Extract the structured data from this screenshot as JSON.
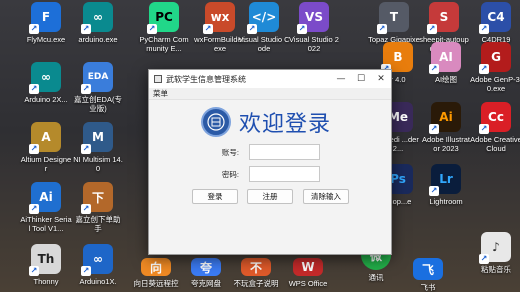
{
  "desktop": {
    "icons": [
      {
        "label": "FlyMcu.exe",
        "color": "#1d6fd8",
        "glyph": "F"
      },
      {
        "label": "arduino.exe",
        "color": "#0a8a8f",
        "glyph": "∞"
      },
      {
        "label": "PyCharm Community E...",
        "color": "#21d789",
        "glyph": "PC"
      },
      {
        "label": "wxFormBuilder.exe",
        "color": "#c94a2a",
        "glyph": "wx"
      },
      {
        "label": "Visual Studio Code",
        "color": "#1f8ad6",
        "glyph": "</>"
      },
      {
        "label": "Visual Studio 2022",
        "color": "#7b4bc9",
        "glyph": "VS"
      },
      {
        "label": "Topaz Gigapixel AI",
        "color": "#555a66",
        "glyph": "T"
      },
      {
        "label": "sheepit-autoupdate.exe",
        "color": "#c53a3a",
        "glyph": "S"
      },
      {
        "label": "C4DR19",
        "color": "#2c4fa8",
        "glyph": "C4"
      },
      {
        "label": "Arduino 2X...",
        "color": "#0a8a8f",
        "glyph": "∞"
      },
      {
        "label": "嘉立创EDA(专业版)",
        "color": "#3a7ddb",
        "glyph": "EDA"
      },
      {
        "label": "r 4.0",
        "color": "#e87d0d",
        "glyph": "B"
      },
      {
        "label": "AI绘图",
        "color": "#d98abf",
        "glyph": "AI"
      },
      {
        "label": "Adobe GenP-3.0.exe",
        "color": "#b31c1c",
        "glyph": "G"
      },
      {
        "label": "Altium Designer",
        "color": "#b58a2b",
        "glyph": "A"
      },
      {
        "label": "NI Multisim 14.0",
        "color": "#2f5a8a",
        "glyph": "M"
      },
      {
        "label": "e Medi ...der 2...",
        "color": "#3a2a5a",
        "glyph": "Me"
      },
      {
        "label": "Adobe Illustrator 2023",
        "color": "#ff9a00",
        "glyph": "Ai"
      },
      {
        "label": "Adobe Creative Cloud",
        "color": "#da1f26",
        "glyph": "Cc"
      },
      {
        "label": "AiThinker Serial Tool V1...",
        "color": "#1f6fd0",
        "glyph": "Ai"
      },
      {
        "label": "嘉立创下单助手",
        "color": "#b3682a",
        "glyph": "下"
      },
      {
        "label": "shop...e",
        "color": "#1a2a5c",
        "glyph": "Ps"
      },
      {
        "label": "Lightroom",
        "color": "#0a1d3c",
        "glyph": "Lr"
      },
      {
        "label": "Thonny",
        "color": "#d8d8d8",
        "glyph": "Th"
      },
      {
        "label": "Arduino1X.",
        "color": "#1e66c8",
        "glyph": "∞"
      },
      {
        "label": "向日葵远程控",
        "color": "#f08a24",
        "glyph": "向"
      },
      {
        "label": "夸克网盘",
        "color": "#3b7bf3",
        "glyph": "夸"
      },
      {
        "label": "不玩盒子说明",
        "color": "#e05a2a",
        "glyph": "不"
      },
      {
        "label": "WPS Office",
        "color": "#c42a2a",
        "glyph": "W"
      },
      {
        "label": "通讯",
        "color": "#23b04a",
        "glyph": "微"
      },
      {
        "label": "飞书",
        "color": "#1a6fe0",
        "glyph": "飞"
      },
      {
        "label": "粘贴音乐",
        "color": "#e8e8e8",
        "glyph": "♪"
      }
    ]
  },
  "window": {
    "title": "武软学生信息管理系统",
    "controls": {
      "minimize": "—",
      "maximize": "☐",
      "close": "✕"
    },
    "menu": "菜单",
    "logo_text": "校徽",
    "headline": "欢迎登录",
    "account_label": "账号:",
    "account_value": "",
    "password_label": "密码:",
    "password_value": "",
    "buttons": {
      "login": "登录",
      "register": "注册",
      "clear": "清除输入"
    }
  }
}
